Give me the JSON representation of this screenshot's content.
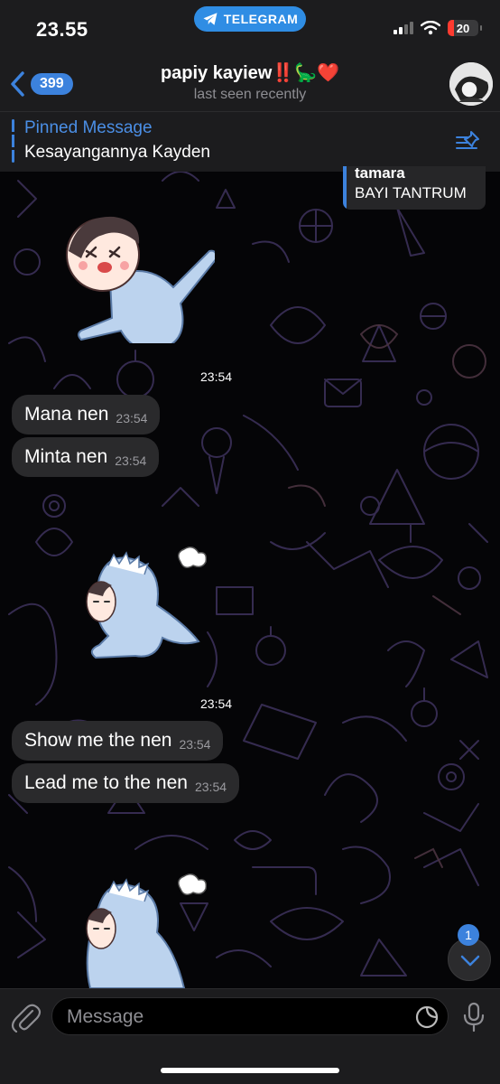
{
  "status_bar": {
    "time": "23.55",
    "app_pill": "TELEGRAM",
    "battery": "20",
    "battery_level": 0.2
  },
  "header": {
    "back_count": "399",
    "title": "papiy kayiew‼️🦕❤️",
    "subtitle": "last seen recently"
  },
  "pinned": {
    "label": "Pinned Message",
    "text": "Kesayangannya Kayden"
  },
  "reply_snippet": {
    "name": "tamara",
    "text": "BAYI TANTRUM"
  },
  "messages": [
    {
      "type": "sticker",
      "name": "crying-baby-sticker",
      "time": "23:54"
    },
    {
      "type": "text",
      "text": "Mana nen",
      "time": "23:54"
    },
    {
      "type": "text",
      "text": "Minta nen",
      "time": "23:54"
    },
    {
      "type": "sticker",
      "name": "dino-costume-sticker",
      "time": "23:54"
    },
    {
      "type": "text",
      "text": "Show me the nen",
      "time": "23:54"
    },
    {
      "type": "text",
      "text": "Lead me to the nen",
      "time": "23:54"
    },
    {
      "type": "sticker",
      "name": "dino-costume-sticker-2"
    }
  ],
  "scroll_down": {
    "unread": "1"
  },
  "input": {
    "placeholder": "Message"
  },
  "colors": {
    "accent": "#3c82dd",
    "bubble": "#2a2a2c",
    "bar_bg": "#1c1c1e",
    "doodle_stroke": "#3a2f55"
  },
  "icons": [
    "telegram-icon",
    "wifi-icon",
    "back-chevron-icon",
    "pin-list-icon",
    "paperclip-icon",
    "sticker-icon",
    "microphone-icon",
    "chevron-down-icon"
  ]
}
